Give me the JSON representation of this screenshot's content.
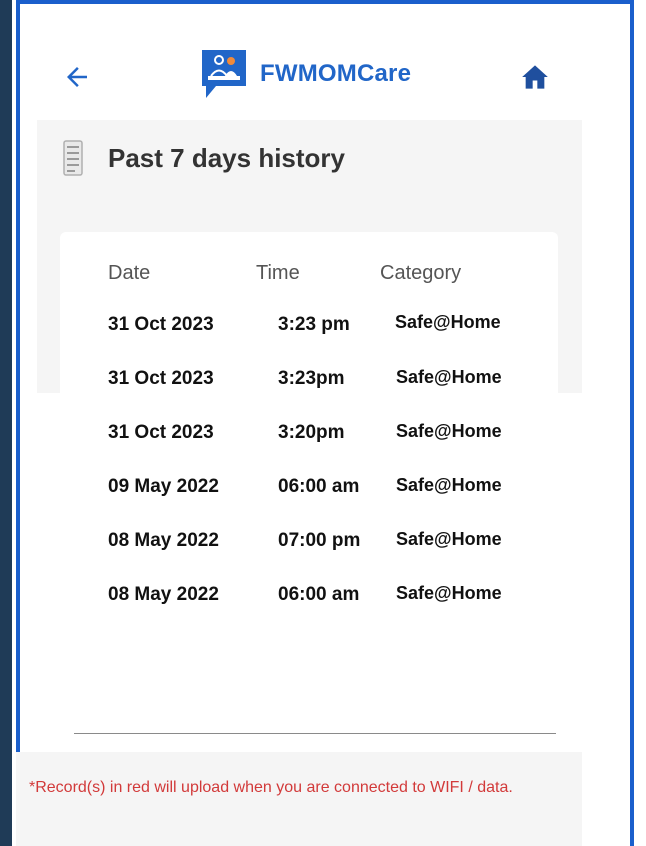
{
  "header": {
    "app_title": "FWMOMCare",
    "back_icon": "arrow-left-icon",
    "home_icon": "home-icon",
    "logo_icon": "fwmomcare-logo"
  },
  "history": {
    "title": "Past 7 days history",
    "title_icon": "document-icon",
    "columns": {
      "date": "Date",
      "time": "Time",
      "category": "Category"
    },
    "rows": [
      {
        "date": "31 Oct 2023",
        "time": "3:23 pm",
        "category": "Safe@Home"
      },
      {
        "date": "31 Oct 2023",
        "time": "3:23pm",
        "category": "Safe@Home"
      },
      {
        "date": "31 Oct 2023",
        "time": "3:20pm",
        "category": "Safe@Home"
      },
      {
        "date": "09 May 2022",
        "time": "06:00 am",
        "category": "Safe@Home"
      },
      {
        "date": "08 May 2022",
        "time": "07:00 pm",
        "category": "Safe@Home"
      },
      {
        "date": "08 May 2022",
        "time": "06:00 am",
        "category": "Safe@Home"
      }
    ]
  },
  "footer": {
    "note": "*Record(s) in red will upload when you are connected to WIFI / data."
  },
  "colors": {
    "brand_blue": "#2166c8",
    "frame_blue": "#1a5fcc",
    "note_red": "#d23a3a"
  }
}
